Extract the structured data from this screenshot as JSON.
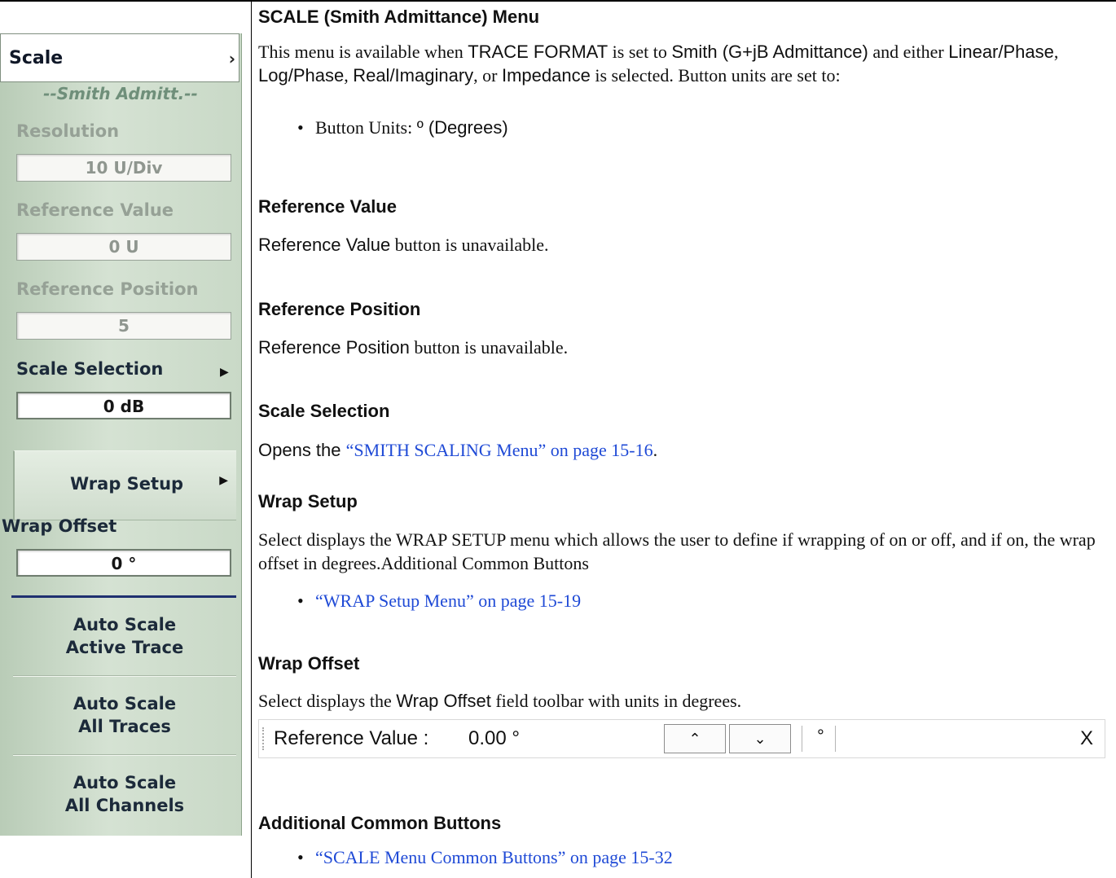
{
  "menu": {
    "title": "Scale",
    "title_chevron": "›",
    "mode_label": "--Smith Admitt.--",
    "resolution": {
      "label": "Resolution",
      "value": "10  U/Div"
    },
    "reference_value": {
      "label": "Reference Value",
      "value": "0  U"
    },
    "reference_position": {
      "label": "Reference Position",
      "value": "5"
    },
    "scale_selection": {
      "label": "Scale Selection",
      "value": "0 dB",
      "arrow": "▶"
    },
    "wrap_setup": {
      "label": "Wrap Setup",
      "arrow": "▶"
    },
    "wrap_offset": {
      "label": "Wrap Offset",
      "value": "0 °"
    },
    "auto_scale_active": {
      "line1": "Auto Scale",
      "line2": "Active Trace"
    },
    "auto_scale_all_traces": {
      "line1": "Auto Scale",
      "line2": "All Traces"
    },
    "auto_scale_all_channels": {
      "line1": "Auto Scale",
      "line2": "All Channels"
    }
  },
  "doc": {
    "title": "SCALE (Smith Admittance) Menu",
    "intro": {
      "t1": "This menu is available when ",
      "s1": "TRACE FORMAT",
      "t2": " is set to ",
      "s2": "Smith (G+jB Admittance)",
      "t3": " and either ",
      "s3": "Linear/Phase",
      "t4": ", ",
      "s4": "Log/Phase",
      "t5": ", ",
      "s5": "Real/Imaginary",
      "t6": ", or ",
      "s6": "Impedance",
      "t7": " is selected. Button units are set to:"
    },
    "units_bullet": {
      "t1": "Button Units: ",
      "s1": "º (Degrees)"
    },
    "ref_value": {
      "heading": "Reference Value",
      "s1": "Reference Value",
      "t1": " button is unavailable."
    },
    "ref_position": {
      "heading": "Reference Position",
      "s1": "Reference Position",
      "t1": " button is unavailable."
    },
    "scale_selection": {
      "heading": "Scale Selection",
      "s1": "Opens the ",
      "link": "“SMITH SCALING Menu” on page 15-16",
      "t1": "."
    },
    "wrap_setup": {
      "heading": "Wrap Setup",
      "text": "Select displays the WRAP SETUP menu which allows the user to define if wrapping of on or off, and if on, the wrap offset in degrees.Additional Common Buttons",
      "link": "“WRAP Setup Menu” on page 15-19"
    },
    "wrap_offset": {
      "heading": "Wrap Offset",
      "t1": "Select displays the ",
      "s1": "Wrap Offset",
      "t2": " field toolbar with units in degrees."
    },
    "common": {
      "heading": "Additional Common Buttons",
      "link": "“SCALE Menu Common Buttons” on page 15-32"
    },
    "bullet_char": "•"
  },
  "toolbar": {
    "label": "Reference Value  :",
    "value": "0.00 °",
    "up_arrow": "⌃",
    "down_arrow": "⌄",
    "unit": "°",
    "close": "X"
  }
}
